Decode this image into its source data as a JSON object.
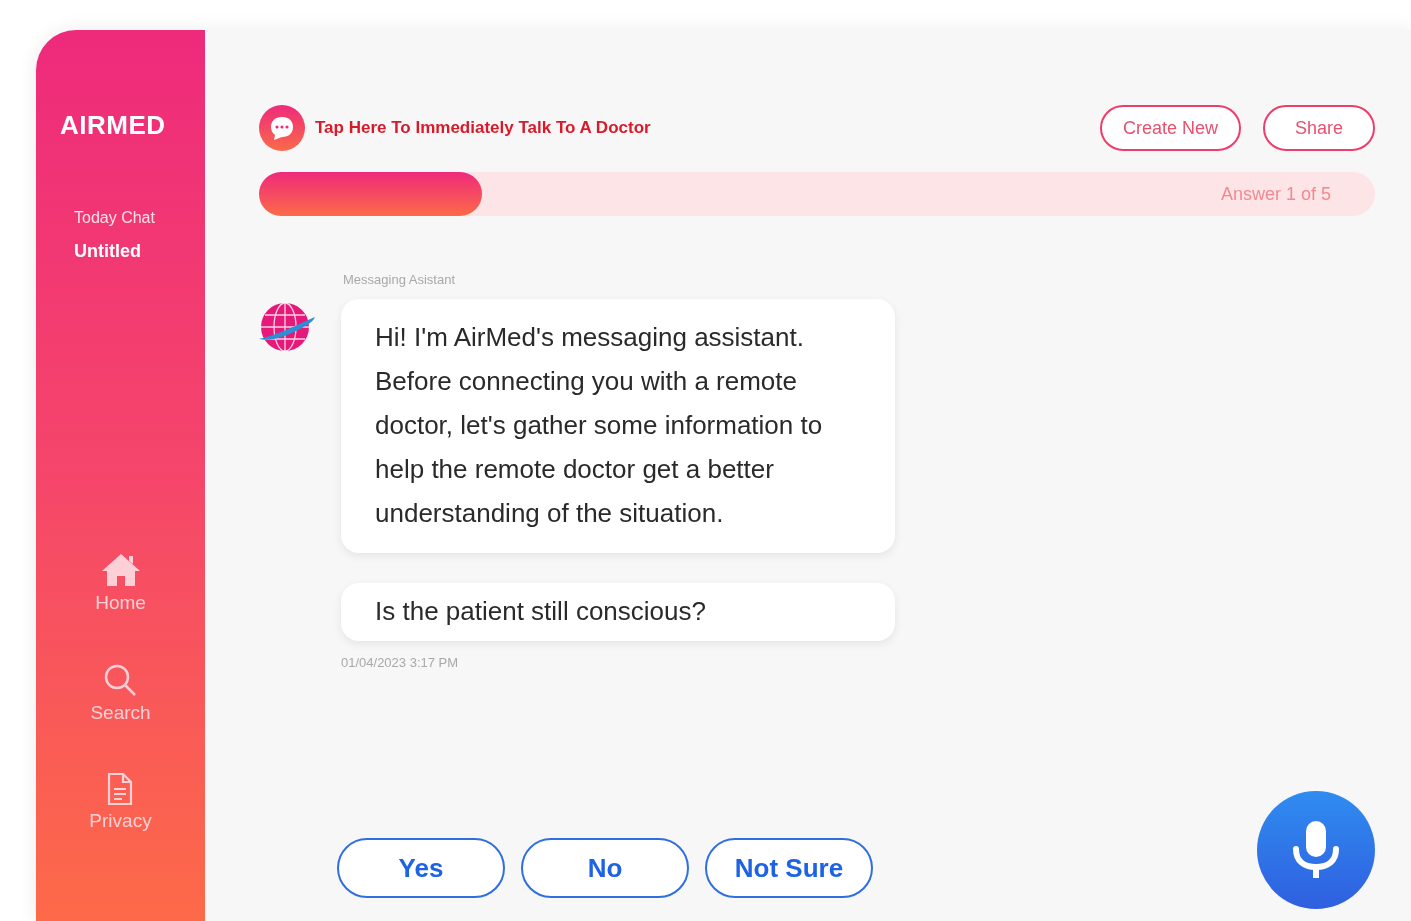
{
  "sidebar": {
    "logo": "AIRMED",
    "section_label": "Today Chat",
    "current_chat": "Untitled",
    "nav": [
      {
        "label": "Home",
        "kind": "home"
      },
      {
        "label": "Search",
        "kind": "search"
      },
      {
        "label": "Privacy",
        "kind": "document"
      }
    ]
  },
  "header": {
    "doctor_link": "Tap Here To Immediately Talk To A Doctor",
    "buttons": [
      "Create New",
      "Share"
    ]
  },
  "progress": {
    "level": 0.2,
    "label": "Answer 1 of 5"
  },
  "chat": {
    "sender": "Messaging Asistant",
    "messages": [
      "Hi! I'm AirMed's messaging assistant. Before connecting you with a remote doctor, let's gather some information to help the remote doctor get a better understanding of the situation.",
      "Is the patient still conscious?"
    ],
    "timestamp": "01/04/2023  3:17 PM"
  },
  "answers": [
    "Yes",
    "No",
    "Not Sure"
  ]
}
